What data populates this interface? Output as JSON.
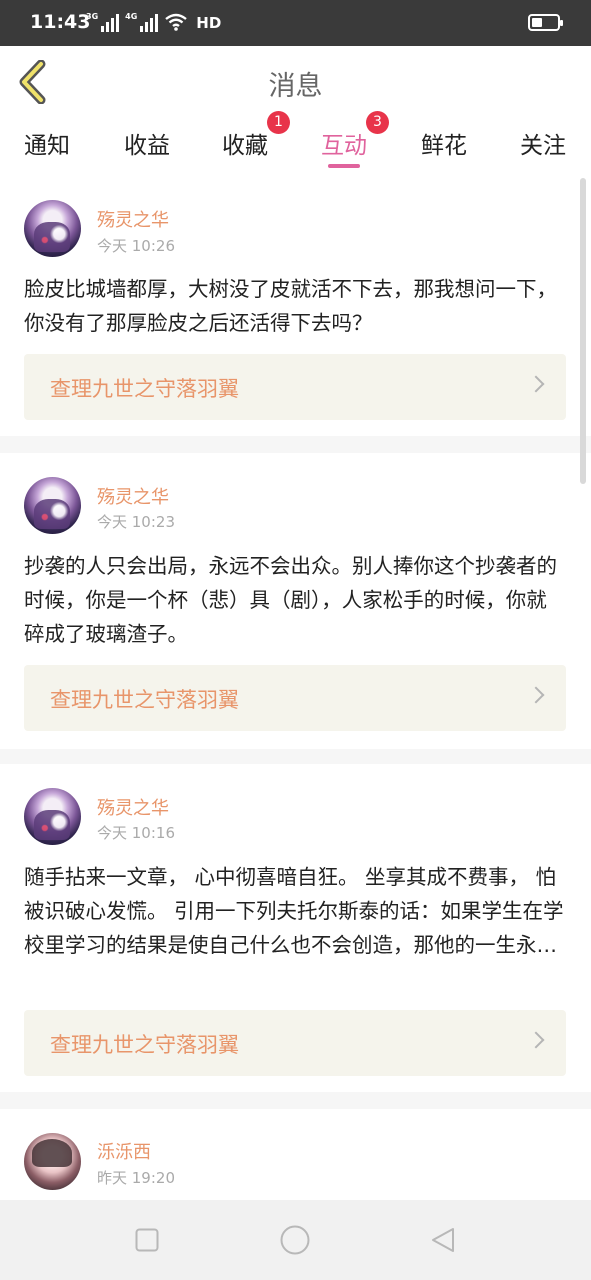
{
  "status_bar": {
    "time": "11:43",
    "net1": "3G",
    "net2": "4G",
    "wifi_label": "HD",
    "battery_level": 0.4,
    "icons": [
      "signal-icon",
      "wifi-icon",
      "battery-icon"
    ]
  },
  "header": {
    "title": "消息",
    "back_icon": "chevron-left-icon"
  },
  "tabs": [
    {
      "label": "通知"
    },
    {
      "label": "收益"
    },
    {
      "label": "收藏",
      "badge": "1"
    },
    {
      "label": "互动",
      "badge": "3",
      "active": true
    },
    {
      "label": "鲜花"
    },
    {
      "label": "关注"
    }
  ],
  "posts": [
    {
      "user": "殇灵之华",
      "time": "今天 10:26",
      "content": "脸皮比城墙都厚，大树没了皮就活不下去，那我想问一下，你没有了那厚脸皮之后还活得下去吗？",
      "ref": "查理九世之守落羽翼"
    },
    {
      "user": "殇灵之华",
      "time": "今天 10:23",
      "content": "抄袭的人只会出局，永远不会出众。别人捧你这个抄袭者的时候，你是一个杯（悲）具（剧），人家松手的时候，你就碎成了玻璃渣子。",
      "ref": "查理九世之守落羽翼"
    },
    {
      "user": "殇灵之华",
      "time": "今天 10:16",
      "content": "随手拈来一文章， 心中彻喜暗自狂。 坐享其成不费事， 怕被识破心发慌。 引用一下列夫托尔斯泰的话：如果学生在学校里学习的结果是使自己什么也不会创造，那他的一生永…",
      "ref": "查理九世之守落羽翼"
    },
    {
      "user": "泺泺西",
      "time": "昨天 19:20"
    }
  ],
  "colors": {
    "accent": "#e0639d",
    "badge": "#e8344a",
    "name": "#e8956a",
    "status_bar": "#3a3a3a",
    "ref_bg": "#f5f4ec"
  },
  "system_nav": [
    "square-icon",
    "circle-icon",
    "triangle-back-icon"
  ]
}
